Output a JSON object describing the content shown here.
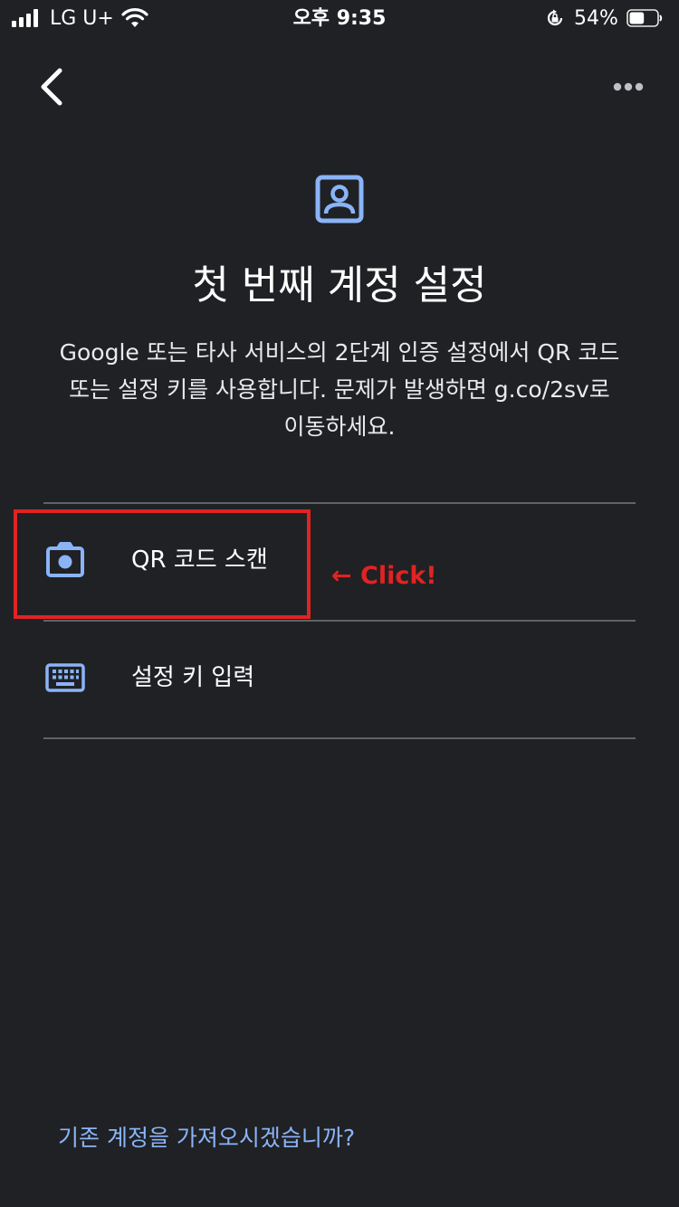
{
  "status_bar": {
    "carrier": "LG U+",
    "time": "오후 9:35",
    "battery_percent": "54%",
    "battery_level": 0.54,
    "icons": [
      "signal-icon",
      "wifi-icon",
      "rotation-lock-icon",
      "battery-icon"
    ]
  },
  "nav": {
    "back_icon": "chevron-left-icon",
    "more_icon": "more-horizontal-icon"
  },
  "header": {
    "icon": "account-box-icon",
    "title": "첫 번째 계정 설정",
    "description_lines": [
      "Google 또는 타사 서비스의 2단계 인증 설정에서 QR 코드",
      "또는 설정 키를 사용합니다. 문제가 발생하면 g.co/2sv로",
      "이동하세요."
    ]
  },
  "options": [
    {
      "icon": "camera-icon",
      "label": "QR 코드 스캔"
    },
    {
      "icon": "keyboard-icon",
      "label": "설정 키 입력"
    }
  ],
  "annotation": {
    "text": "← Click!",
    "color": "#e12323"
  },
  "footer": {
    "import_link": "기존 계정을 가져오시겠습니까?"
  },
  "colors": {
    "background": "#202124",
    "accent": "#8ab4f8",
    "divider": "#5f6368",
    "text": "#ffffff"
  }
}
